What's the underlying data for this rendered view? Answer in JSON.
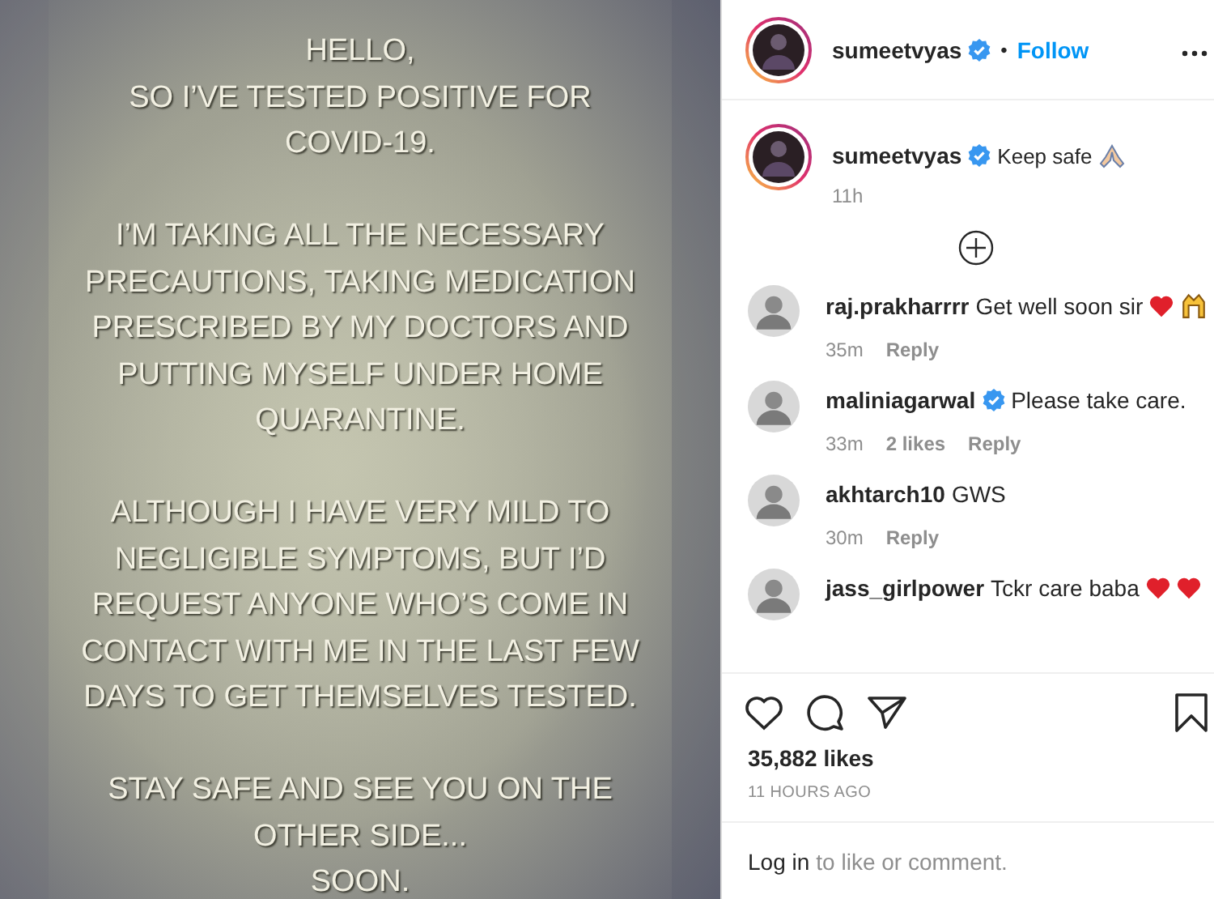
{
  "post_image": {
    "paragraphs": [
      [
        "HELLO,",
        "SO I’VE TESTED POSITIVE FOR",
        "COVID-19."
      ],
      [
        "I’M TAKING ALL THE NECESSARY",
        "PRECAUTIONS, TAKING MEDICATION",
        "PRESCRIBED BY MY DOCTORS AND",
        "PUTTING MYSELF UNDER HOME",
        "QUARANTINE."
      ],
      [
        "ALTHOUGH I HAVE VERY MILD TO",
        "NEGLIGIBLE SYMPTOMS, BUT I’D",
        "REQUEST ANYONE WHO’S COME IN",
        "CONTACT WITH ME IN THE LAST FEW",
        "DAYS TO GET THEMSELVES TESTED."
      ],
      [
        "STAY SAFE AND SEE YOU ON THE",
        "OTHER SIDE...",
        "SOON."
      ]
    ]
  },
  "header": {
    "username": "sumeetvyas",
    "verified": true,
    "separator": "•",
    "follow": "Follow"
  },
  "caption": {
    "username": "sumeetvyas",
    "verified": true,
    "text": "Keep safe",
    "emojis": [
      {
        "kind": "pray"
      }
    ],
    "time": "11h"
  },
  "comments": [
    {
      "username": "raj.prakharrrr",
      "verified": false,
      "text": "Get well soon sir",
      "emojis": [
        {
          "kind": "heart"
        },
        {
          "kind": "hands"
        }
      ],
      "time": "35m",
      "reply": "Reply"
    },
    {
      "username": "maliniagarwal",
      "verified": true,
      "text": "Please take care.",
      "time": "33m",
      "likes": "2 likes",
      "reply": "Reply"
    },
    {
      "username": "akhtarch10",
      "verified": false,
      "text": "GWS",
      "time": "30m",
      "reply": "Reply"
    },
    {
      "username": "jass_girlpower",
      "verified": false,
      "text": "Tckr care baba",
      "emojis": [
        {
          "kind": "heart"
        },
        {
          "kind": "heart"
        }
      ]
    }
  ],
  "likes": "35,882 likes",
  "timestamp": "11 HOURS AGO",
  "login": {
    "link": "Log in",
    "text": "to like or comment."
  }
}
